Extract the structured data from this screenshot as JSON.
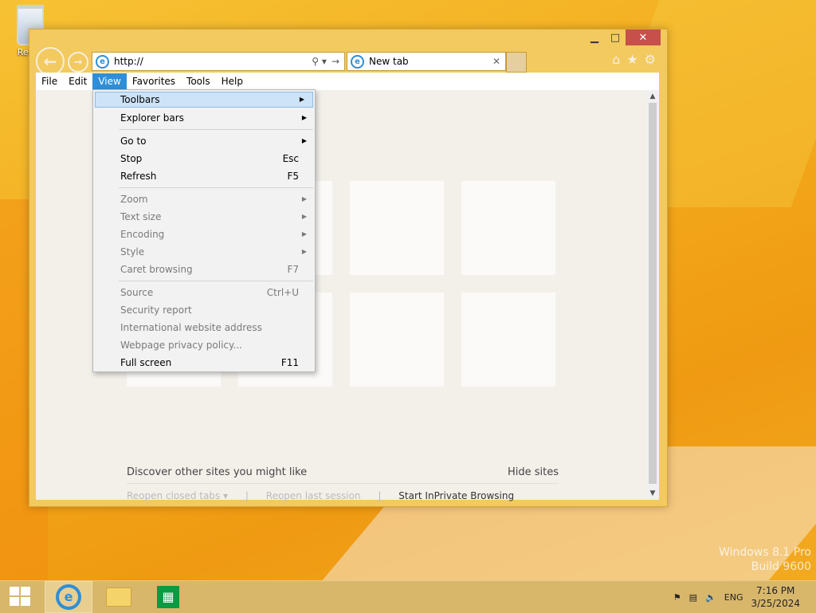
{
  "desktop": {
    "recycle_label": "Recyc"
  },
  "watermark": {
    "line1": "Windows 8.1 Pro",
    "line2": "Build 9600"
  },
  "ie": {
    "address": "http://",
    "tab_title": "New tab",
    "menus": [
      "File",
      "Edit",
      "View",
      "Favorites",
      "Tools",
      "Help"
    ],
    "active_menu": "View",
    "discover_text": "Discover other sites you might like",
    "hide_sites": "Hide sites",
    "reopen_tabs": "Reopen closed tabs ▾",
    "reopen_session": "Reopen last session",
    "inprivate": "Start InPrivate Browsing",
    "separator": "|"
  },
  "view_menu": [
    {
      "label": "Toolbars",
      "shortcut": "",
      "submenu": true,
      "disabled": false,
      "hover": true
    },
    {
      "label": "Explorer bars",
      "shortcut": "",
      "submenu": true,
      "disabled": false
    },
    {
      "sep": true
    },
    {
      "label": "Go to",
      "shortcut": "",
      "submenu": true,
      "disabled": false
    },
    {
      "label": "Stop",
      "shortcut": "Esc",
      "submenu": false,
      "disabled": false
    },
    {
      "label": "Refresh",
      "shortcut": "F5",
      "submenu": false,
      "disabled": false
    },
    {
      "sep": true
    },
    {
      "label": "Zoom",
      "shortcut": "",
      "submenu": true,
      "disabled": true
    },
    {
      "label": "Text size",
      "shortcut": "",
      "submenu": true,
      "disabled": true
    },
    {
      "label": "Encoding",
      "shortcut": "",
      "submenu": true,
      "disabled": true
    },
    {
      "label": "Style",
      "shortcut": "",
      "submenu": true,
      "disabled": true
    },
    {
      "label": "Caret browsing",
      "shortcut": "F7",
      "submenu": false,
      "disabled": true
    },
    {
      "sep": true
    },
    {
      "label": "Source",
      "shortcut": "Ctrl+U",
      "submenu": false,
      "disabled": true
    },
    {
      "label": "Security report",
      "shortcut": "",
      "submenu": false,
      "disabled": true
    },
    {
      "label": "International website address",
      "shortcut": "",
      "submenu": false,
      "disabled": true
    },
    {
      "label": "Webpage privacy policy...",
      "shortcut": "",
      "submenu": false,
      "disabled": true
    },
    {
      "label": "Full screen",
      "shortcut": "F11",
      "submenu": false,
      "disabled": false
    }
  ],
  "taskbar": {
    "lang": "ENG",
    "time": "7:16 PM",
    "date": "3/25/2024"
  },
  "colors": {
    "accent": "#2f8ed6",
    "window_frame": "#f2ca5f",
    "close": "#c7504b"
  }
}
